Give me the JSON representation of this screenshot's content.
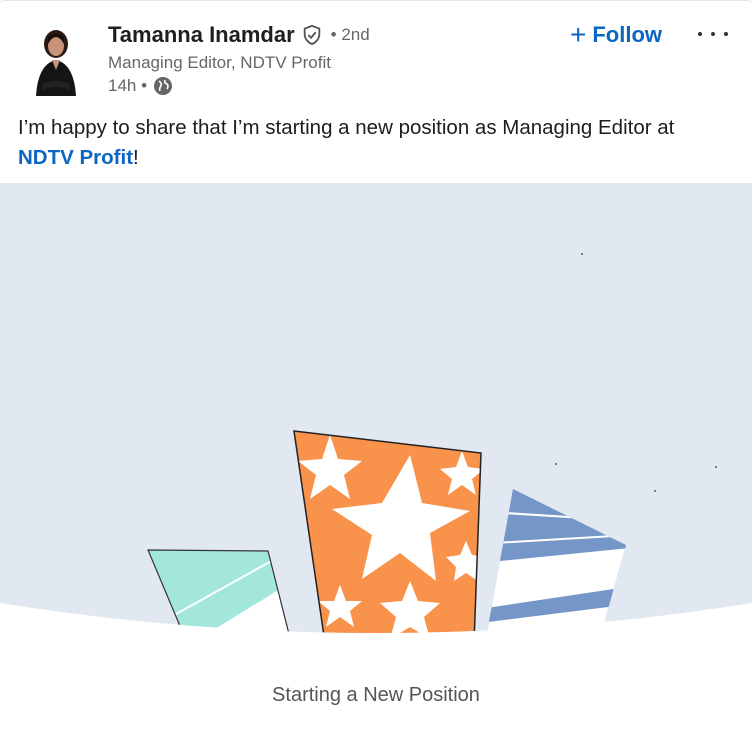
{
  "post": {
    "author": {
      "name": "Tamanna Inamdar",
      "degree": "• 2nd",
      "headline": "Managing Editor, NDTV Profit",
      "time": "14h •"
    },
    "actions": {
      "follow_label": "Follow",
      "follow_icon": "plus-icon",
      "more_icon": "ellipsis-icon"
    },
    "text": {
      "before_link": "I’m happy to share that I’m starting a new position as Managing Editor at ",
      "link": "NDTV Profit",
      "after_link": "!"
    },
    "media": {
      "caption": "Starting a New Position",
      "background_color": "#e2e8f1"
    }
  },
  "colors": {
    "accent": "#0a66c2",
    "gift_orange": "#f9924b",
    "gift_mint": "#a2e6dc",
    "gift_blue": "#7596c8"
  }
}
